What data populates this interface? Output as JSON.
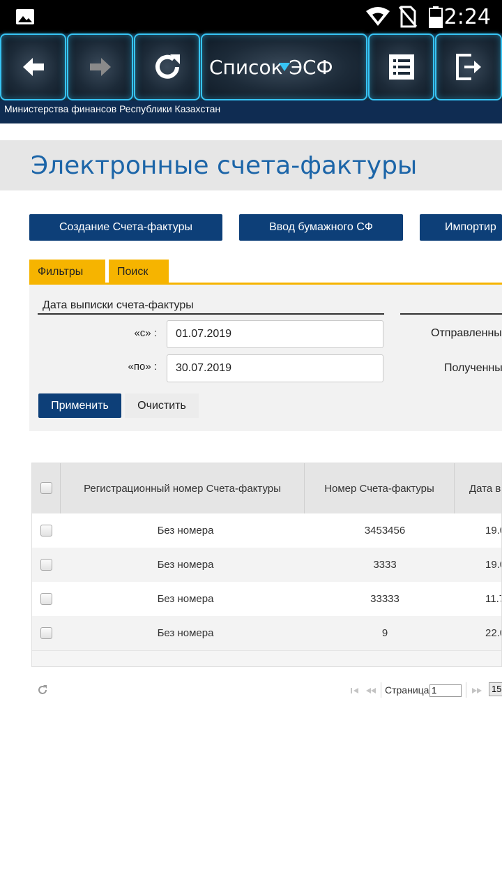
{
  "status_bar": {
    "time": "2:24",
    "icons": [
      "image-icon",
      "wifi-icon",
      "no-sim-icon",
      "battery-icon"
    ]
  },
  "toolbar": {
    "title": "Список ЭСФ",
    "buttons": [
      "back-arrow-icon",
      "forward-arrow-icon",
      "refresh-icon",
      "list-icon",
      "exit-icon"
    ]
  },
  "header": {
    "ministry": "Министерства финансов Республики Казахстан"
  },
  "page_title": "Электронные счета-фактуры",
  "actions": {
    "create": "Создание Счета-фактуры",
    "paper": "Ввод бумажного СФ",
    "import": "Импортир"
  },
  "tabs": {
    "filters": "Фильтры",
    "search": "Поиск"
  },
  "filters": {
    "date_title": "Дата выписки счета-фактуры",
    "from_label": "«с» :",
    "from_value": "01.07.2019",
    "to_label": "«по» :",
    "to_value": "30.07.2019",
    "sent_label": "Отправленны",
    "received_label": "Полученны",
    "apply": "Применить",
    "clear": "Очистить"
  },
  "table": {
    "columns": [
      "Регистрационный номер Счета-фактуры",
      "Номер Счета-фактуры",
      "Дата в"
    ],
    "rows": [
      {
        "reg": "Без номера",
        "num": "3453456",
        "date": "19.0"
      },
      {
        "reg": "Без номера",
        "num": "3333",
        "date": "19.0"
      },
      {
        "reg": "Без номера",
        "num": "33333",
        "date": "11.7"
      },
      {
        "reg": "Без номера",
        "num": "9",
        "date": "22.0"
      }
    ]
  },
  "pager": {
    "page_label": "Страница",
    "page_value": "1",
    "page_size": "15"
  },
  "colors": {
    "accent": "#0d3f78",
    "tab": "#f6b400",
    "title": "#1c65a8",
    "glow": "#37c5f5"
  }
}
